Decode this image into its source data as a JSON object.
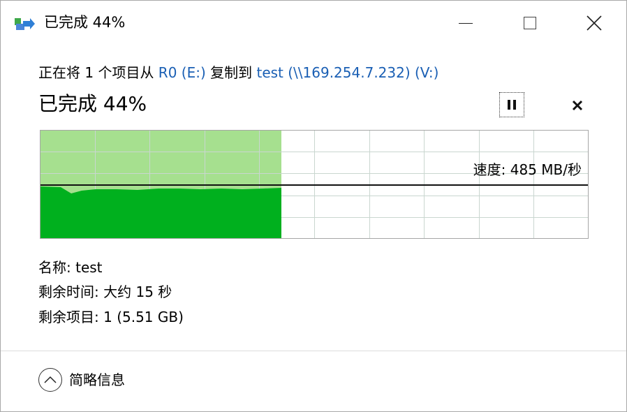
{
  "window": {
    "title": "已完成 44%"
  },
  "copy": {
    "prefix": "正在将 1 个项目从 ",
    "source": "R0 (E:)",
    "middle": " 复制到 ",
    "destination": "test (\\\\169.254.7.232) (V:)"
  },
  "progress": {
    "title": "已完成 44%",
    "percent": 44
  },
  "speed": {
    "label": "速度: 485 MB/秒"
  },
  "details": {
    "name_label": "名称:",
    "name_value": "test",
    "time_label": "剩余时间:",
    "time_value": "大约 15 秒",
    "items_label": "剩余项目:",
    "items_value": "1 (5.51 GB)"
  },
  "footer": {
    "toggle_label": "简略信息"
  },
  "colors": {
    "progress_fill": "#a6e08f",
    "speed_fill": "#00b01e",
    "grid": "#c9d6d0",
    "link": "#1a5fb4"
  },
  "icons": {
    "app": "copy-arrow-icon",
    "pause": "pause-icon",
    "cancel": "close-icon",
    "toggle": "chevron-up-icon"
  }
}
